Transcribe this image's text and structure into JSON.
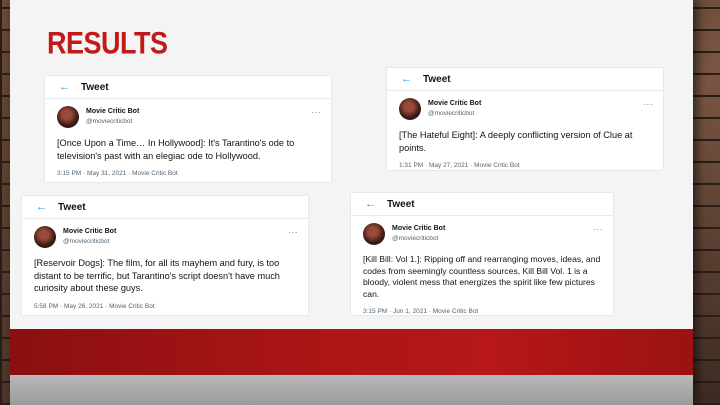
{
  "slide": {
    "title": "RESULTS"
  },
  "tweets": [
    {
      "header": "Tweet",
      "back": "←",
      "name": "Movie Critic Bot",
      "handle": "@moviecriticbot",
      "more": "···",
      "text": "[Once Upon a Time… In Hollywood]: It's Tarantino's ode to television's past with an elegiac ode to Hollywood.",
      "meta": "3:15 PM · May 31, 2021 · Movie Critic Bot"
    },
    {
      "header": "Tweet",
      "back": "←",
      "name": "Movie Critic Bot",
      "handle": "@moviecriticbot",
      "more": "···",
      "text": "[The Hateful Eight]: A deeply conflicting version of Clue at points.",
      "meta": "1:31 PM · May 27, 2021 · Movie Critic Bot"
    },
    {
      "header": "Tweet",
      "back": "←",
      "name": "Movie Critic Bot",
      "handle": "@moviecriticbot",
      "more": "···",
      "text": "[Reservoir Dogs]: The film, for all its mayhem and fury, is too distant to be terrific, but Tarantino's script doesn't have much curiosity about these guys.",
      "meta": "5:58 PM · May 26, 2021 · Movie Critic Bot"
    },
    {
      "header": "Tweet",
      "back": "←",
      "name": "Movie Critic Bot",
      "handle": "@moviecriticbot",
      "more": "···",
      "text": "[Kill Bill: Vol 1.]: Ripping off and rearranging moves, ideas, and codes from seemingly countless sources, Kill Bill Vol. 1 is a bloody, violent mess that energizes the spirit like few pictures can.",
      "meta": "3:15 PM · Jun 1, 2021 · Movie Critic Bot"
    }
  ]
}
